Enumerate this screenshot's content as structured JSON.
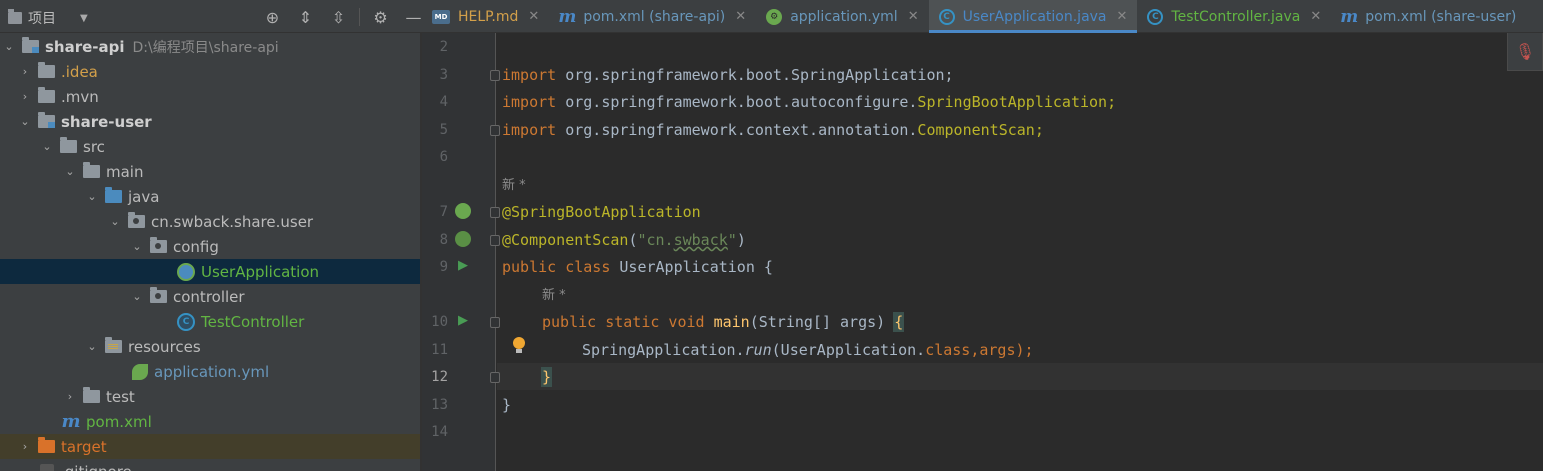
{
  "project_panel": {
    "title": "项目",
    "toolbar_icons": [
      "locate-icon",
      "expand-all-icon",
      "collapse-all-icon",
      "gear-icon",
      "minimize-icon"
    ]
  },
  "tabs": [
    {
      "label": "HELP.md",
      "icon": "markdown-icon",
      "active": false
    },
    {
      "label": "pom.xml (share-api)",
      "icon": "maven-icon",
      "active": false
    },
    {
      "label": "application.yml",
      "icon": "spring-config-icon",
      "active": false
    },
    {
      "label": "UserApplication.java",
      "icon": "spring-boot-class-icon",
      "active": true
    },
    {
      "label": "TestController.java",
      "icon": "class-icon",
      "active": false
    },
    {
      "label": "pom.xml (share-user)",
      "icon": "maven-icon",
      "active": false
    }
  ],
  "tree": {
    "root": {
      "label": "share-api",
      "path": "D:\\编程项目\\share-api"
    },
    "items": [
      {
        "label": ".idea"
      },
      {
        "label": ".mvn"
      },
      {
        "label": "share-user"
      },
      {
        "label": "src"
      },
      {
        "label": "main"
      },
      {
        "label": "java"
      },
      {
        "label": "cn.swback.share.user"
      },
      {
        "label": "config"
      },
      {
        "label": "UserApplication"
      },
      {
        "label": "controller"
      },
      {
        "label": "TestController"
      },
      {
        "label": "resources"
      },
      {
        "label": "application.yml"
      },
      {
        "label": "test"
      },
      {
        "label": "pom.xml"
      },
      {
        "label": "target"
      },
      {
        "label": ".gitignore"
      }
    ]
  },
  "editor": {
    "line_numbers": [
      "2",
      "3",
      "4",
      "5",
      "6",
      "7",
      "8",
      "9",
      "10",
      "11",
      "12",
      "13",
      "14"
    ],
    "current_line": "12",
    "inlay_hint": "新 *",
    "lines": {
      "l3_kw": "import",
      "l3_rest": " org.springframework.boot.SpringApplication;",
      "l4_kw": "import",
      "l4_rest": " org.springframework.boot.autoconfigure.",
      "l4_cls": "SpringBootApplication;",
      "l5_kw": "import",
      "l5_rest": " org.springframework.context.annotation.",
      "l5_cls": "ComponentScan;",
      "l7": "@SpringBootApplication",
      "l8_ann": "@ComponentScan",
      "l8_open": "(",
      "l8_str_a": "\"cn.",
      "l8_str_b": "swback",
      "l8_str_c": "\"",
      "l8_close": ")",
      "l9_kw": "public class",
      "l9_rest": " UserApplication {",
      "l10_kw": "public static void",
      "l10_fn": "main",
      "l10_rest": "(String[] args) ",
      "l10_brace": "{",
      "l11_a": "SpringApplication.",
      "l11_run": "run",
      "l11_b": "(UserApplication.",
      "l11_cls": "class",
      "l11_c": ",args);",
      "l12": "}",
      "l13": "}"
    }
  },
  "colors": {
    "keyword": "#cc7832",
    "annotation": "#bbb529",
    "string": "#6a8759",
    "method": "#ffc66d",
    "text": "#a9b7c6",
    "selection": "#0d293e",
    "active_tab_underline": "#4a88c7"
  }
}
